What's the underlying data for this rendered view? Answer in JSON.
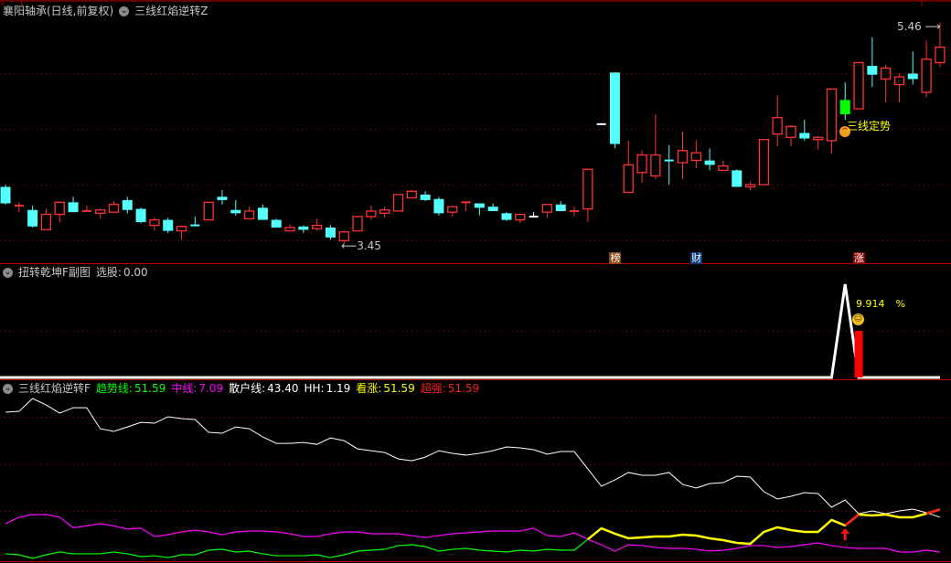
{
  "header": {
    "stock_title": "襄阳轴承(日线,前复权)",
    "main_indicator": "三线红焰逆转Z"
  },
  "sub1": {
    "title": "扭转乾坤F副图",
    "xuangu_label": "选股:",
    "xuangu_value": "0.00",
    "signal_pct": "9.914",
    "pct_sign": "%"
  },
  "sub2": {
    "title": "三线红焰逆转F",
    "legend": [
      {
        "label": "趋势线:",
        "value": "51.59",
        "color": "#00ff00"
      },
      {
        "label": "中线:",
        "value": "7.09",
        "color": "#ff00ff"
      },
      {
        "label": "散户线:",
        "value": "43.40",
        "color": "#ffffff"
      },
      {
        "label": "HH:",
        "value": "1.19",
        "color": "#ffffff"
      },
      {
        "label": "看涨:",
        "value": "51.59",
        "color": "#ffff00"
      },
      {
        "label": "超强:",
        "value": "51.59",
        "color": "#ff2020"
      }
    ]
  },
  "annotations": {
    "high_label": "5.46",
    "low_label": "3.45",
    "signal_text": "三线定势",
    "badges": [
      {
        "text": "榜",
        "index": 45,
        "color": "#8b4a10"
      },
      {
        "text": "财",
        "index": 51,
        "color": "#0a3a78"
      },
      {
        "text": "涨",
        "index": 63,
        "color": "#8b0a0a"
      }
    ]
  },
  "colors": {
    "up": "#ff3232",
    "down": "#54ffff",
    "signal": "#00ff00",
    "grid": "#8b0000"
  },
  "chart_data": [
    {
      "type": "candlestick",
      "title": "襄阳轴承(日线,前复权)",
      "high": 5.46,
      "low": 3.45,
      "high_index": 69,
      "low_index": 25,
      "signal_index": 62,
      "ohlc": [
        [
          3.97,
          3.99,
          3.81,
          3.82
        ],
        [
          3.79,
          3.83,
          3.74,
          3.8
        ],
        [
          3.76,
          3.8,
          3.6,
          3.61
        ],
        [
          3.58,
          3.77,
          3.58,
          3.72
        ],
        [
          3.72,
          3.83,
          3.65,
          3.83
        ],
        [
          3.83,
          3.88,
          3.74,
          3.74
        ],
        [
          3.74,
          3.8,
          3.74,
          3.75
        ],
        [
          3.73,
          3.77,
          3.68,
          3.76
        ],
        [
          3.74,
          3.84,
          3.74,
          3.81
        ],
        [
          3.85,
          3.88,
          3.73,
          3.76
        ],
        [
          3.77,
          3.78,
          3.64,
          3.65
        ],
        [
          3.62,
          3.69,
          3.57,
          3.67
        ],
        [
          3.67,
          3.69,
          3.55,
          3.57
        ],
        [
          3.57,
          3.62,
          3.49,
          3.61
        ],
        [
          3.62,
          3.7,
          3.61,
          3.61
        ],
        [
          3.67,
          3.83,
          3.67,
          3.83
        ],
        [
          3.88,
          3.94,
          3.81,
          3.85
        ],
        [
          3.76,
          3.85,
          3.71,
          3.73
        ],
        [
          3.68,
          3.79,
          3.67,
          3.75
        ],
        [
          3.78,
          3.81,
          3.67,
          3.67
        ],
        [
          3.67,
          3.68,
          3.6,
          3.6
        ],
        [
          3.57,
          3.63,
          3.57,
          3.6
        ],
        [
          3.61,
          3.62,
          3.55,
          3.58
        ],
        [
          3.59,
          3.68,
          3.57,
          3.62
        ],
        [
          3.6,
          3.62,
          3.49,
          3.51
        ],
        [
          3.48,
          3.57,
          3.45,
          3.56
        ],
        [
          3.57,
          3.7,
          3.57,
          3.7
        ],
        [
          3.7,
          3.8,
          3.67,
          3.75
        ],
        [
          3.73,
          3.79,
          3.69,
          3.76
        ],
        [
          3.75,
          3.9,
          3.75,
          3.9
        ],
        [
          3.87,
          3.94,
          3.87,
          3.93
        ],
        [
          3.9,
          3.93,
          3.84,
          3.85
        ],
        [
          3.86,
          3.88,
          3.71,
          3.73
        ],
        [
          3.74,
          3.79,
          3.7,
          3.79
        ],
        [
          3.82,
          3.83,
          3.75,
          3.83
        ],
        [
          3.82,
          3.82,
          3.71,
          3.78
        ],
        [
          3.79,
          3.82,
          3.75,
          3.75
        ],
        [
          3.73,
          3.74,
          3.66,
          3.67
        ],
        [
          3.67,
          3.72,
          3.64,
          3.72
        ],
        [
          3.7,
          3.74,
          3.69,
          3.7
        ],
        [
          3.74,
          3.81,
          3.69,
          3.81
        ],
        [
          3.81,
          3.84,
          3.75,
          3.75
        ],
        [
          3.74,
          3.79,
          3.7,
          3.75
        ],
        [
          3.77,
          4.13,
          3.65,
          4.13
        ],
        [
          4.54,
          4.54,
          4.54,
          4.54
        ],
        [
          5.01,
          5.01,
          4.32,
          4.36
        ],
        [
          3.92,
          4.39,
          3.92,
          4.17
        ],
        [
          4.1,
          4.3,
          4.01,
          4.26
        ],
        [
          4.07,
          4.63,
          4.04,
          4.26
        ],
        [
          4.21,
          4.35,
          3.99,
          4.2
        ],
        [
          4.19,
          4.47,
          4.04,
          4.3
        ],
        [
          4.21,
          4.39,
          4.14,
          4.28
        ],
        [
          4.21,
          4.32,
          4.12,
          4.17
        ],
        [
          4.12,
          4.21,
          4.12,
          4.16
        ],
        [
          4.12,
          4.13,
          3.97,
          3.97
        ],
        [
          3.97,
          4.02,
          3.94,
          3.99
        ],
        [
          3.99,
          4.4,
          3.99,
          4.4
        ],
        [
          4.45,
          4.8,
          4.34,
          4.6
        ],
        [
          4.42,
          4.53,
          4.34,
          4.52
        ],
        [
          4.46,
          4.58,
          4.39,
          4.41
        ],
        [
          4.4,
          4.43,
          4.31,
          4.42
        ],
        [
          4.39,
          4.86,
          4.27,
          4.86
        ],
        [
          4.76,
          4.92,
          4.58,
          4.63
        ],
        [
          4.68,
          5.1,
          4.68,
          5.1
        ],
        [
          5.07,
          5.33,
          4.88,
          4.99
        ],
        [
          4.95,
          5.08,
          4.74,
          5.05
        ],
        [
          4.9,
          5.0,
          4.74,
          4.97
        ],
        [
          5.0,
          5.2,
          4.9,
          4.95
        ],
        [
          4.83,
          5.3,
          4.78,
          5.13
        ],
        [
          5.1,
          5.46,
          5.06,
          5.24
        ]
      ]
    },
    {
      "type": "line",
      "title": "扭转乾坤F副图",
      "signal_line_peak_index": 62,
      "signal_line_peak": 1.0,
      "bar_index": 63,
      "bar_value": 0.5
    },
    {
      "type": "line",
      "title": "三线红焰逆转F",
      "kanzhang_from_index": 43,
      "chaoqiang_segments": [
        [
          62,
          63
        ],
        [
          68,
          69
        ]
      ],
      "arrow_index": 62,
      "series": [
        {
          "name": "散户线",
          "color": "#ffffff",
          "values": [
            153.2,
            154.1,
            167.5,
            160.8,
            152.2,
            157.9,
            157.9,
            135.9,
            133.1,
            137.8,
            142.6,
            141.7,
            148.4,
            146.5,
            145.6,
            132.2,
            131.2,
            137.8,
            135.9,
            127.3,
            120.6,
            120.6,
            121.6,
            119.6,
            126.3,
            123.5,
            114.9,
            113.0,
            111.1,
            104.4,
            102.5,
            106.3,
            113.0,
            110.2,
            108.3,
            110.2,
            113.0,
            116.9,
            115.9,
            114.0,
            109.3,
            112.1,
            112.1,
            93.9,
            75.8,
            82.5,
            90.2,
            87.3,
            87.3,
            90.2,
            77.7,
            73.9,
            78.6,
            79.6,
            86.3,
            85.4,
            70.1,
            62.5,
            65.3,
            69.1,
            68.2,
            53.9,
            61.5,
            47.1,
            50.0,
            47.1,
            50.0,
            51.9,
            48.1,
            43.4
          ]
        },
        {
          "name": "中线",
          "color": "#ff00ff",
          "values": [
            36.7,
            43.4,
            46.2,
            46.2,
            43.4,
            32.5,
            34.4,
            36.7,
            34.4,
            31.1,
            32.0,
            23.3,
            25.2,
            28.1,
            30.0,
            28.1,
            25.2,
            28.1,
            29.0,
            29.0,
            28.1,
            26.2,
            23.3,
            23.3,
            26.2,
            28.1,
            28.1,
            26.2,
            26.2,
            26.2,
            24.2,
            22.3,
            24.2,
            26.2,
            27.1,
            28.1,
            29.0,
            29.0,
            29.0,
            32.0,
            24.2,
            23.3,
            27.1,
            20.4,
            14.7,
            8.0,
            14.7,
            13.8,
            11.8,
            10.9,
            10.9,
            10.0,
            8.0,
            9.0,
            10.9,
            13.8,
            13.8,
            11.8,
            12.8,
            14.7,
            16.6,
            13.8,
            11.8,
            10.9,
            10.9,
            10.9,
            7.1,
            7.1,
            9.0,
            7.09
          ]
        },
        {
          "name": "趋势线",
          "color": "#00ff00",
          "values": [
            5.2,
            4.2,
            0.4,
            4.2,
            7.1,
            5.2,
            5.2,
            5.2,
            7.1,
            5.2,
            2.3,
            3.2,
            1.3,
            4.2,
            4.2,
            9.0,
            9.9,
            7.1,
            8.0,
            5.2,
            3.2,
            3.2,
            3.2,
            4.2,
            1.3,
            4.2,
            8.0,
            9.0,
            9.9,
            13.8,
            14.7,
            12.8,
            8.0,
            9.9,
            10.9,
            9.0,
            8.0,
            7.1,
            9.0,
            8.0,
            9.9,
            9.0,
            9.0,
            20.4,
            31.9,
            26.2,
            21.4,
            22.3,
            23.3,
            23.3,
            25.2,
            24.3,
            21.4,
            19.5,
            16.6,
            15.7,
            28.1,
            32.9,
            30.0,
            28.1,
            28.1,
            40.5,
            34.8,
            46.2,
            45.3,
            46.2,
            43.4,
            43.4,
            47.2,
            51.59
          ]
        }
      ]
    }
  ]
}
